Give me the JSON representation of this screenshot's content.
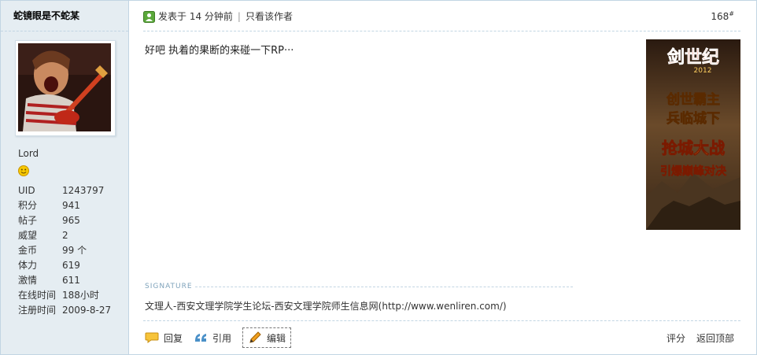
{
  "user": {
    "name": "蛇镜眼是不蛇某",
    "rank": "Lord",
    "stats": [
      {
        "label": "UID",
        "value": "1243797"
      },
      {
        "label": "积分",
        "value": "941"
      },
      {
        "label": "帖子",
        "value": "965"
      },
      {
        "label": "威望",
        "value": "2"
      },
      {
        "label": "金币",
        "value": "99 个"
      },
      {
        "label": "体力",
        "value": "619"
      },
      {
        "label": "激情",
        "value": "611"
      },
      {
        "label": "在线时间",
        "value": "188小时"
      },
      {
        "label": "注册时间",
        "value": "2009-8-27"
      }
    ]
  },
  "post": {
    "posted": "发表于 14 分钟前",
    "only_author": "只看该作者",
    "floor": "168",
    "floor_sup": "#",
    "content": "好吧  执着的果断的来碰一下RP···",
    "signature_label": "SIGNATURE",
    "signature": "文理人-西安文理学院学生论坛-西安文理学院师生信息网(http://www.wenliren.com/)"
  },
  "ad": {
    "title": "剑世纪",
    "year": "2012",
    "line1": "创世霸主",
    "line2": "兵临城下",
    "line3": "抢城大战",
    "line4": "引爆巅峰对决"
  },
  "actions": {
    "reply": "回复",
    "quote": "引用",
    "edit": "编辑",
    "rate": "评分",
    "top": "返回顶部"
  },
  "colors": {
    "sidebar_bg": "#e5edf2",
    "border": "#c2d5e3",
    "accent": "#7fa3bb"
  }
}
